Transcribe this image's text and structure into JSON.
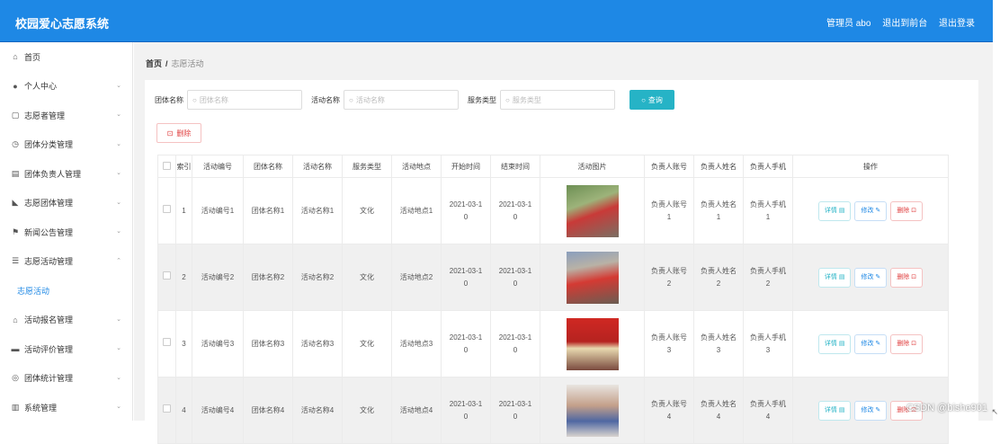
{
  "header": {
    "title": "校园爱心志愿系统",
    "admin": "管理员 abo",
    "back_front": "退出到前台",
    "logout": "退出登录"
  },
  "sidebar": {
    "items": [
      {
        "label": "首页",
        "icon": "home-icon",
        "glyph": "⌂",
        "chev": ""
      },
      {
        "label": "个人中心",
        "icon": "user-icon",
        "glyph": "●",
        "chev": "⌄"
      },
      {
        "label": "志愿者管理",
        "icon": "card-icon",
        "glyph": "▢",
        "chev": "⌄"
      },
      {
        "label": "团体分类管理",
        "icon": "clock-icon",
        "glyph": "◷",
        "chev": "⌄"
      },
      {
        "label": "团体负责人管理",
        "icon": "book-icon",
        "glyph": "▤",
        "chev": "⌄"
      },
      {
        "label": "志愿团体管理",
        "icon": "thumb-icon",
        "glyph": "◣",
        "chev": "⌄"
      },
      {
        "label": "新闻公告管理",
        "icon": "flag-icon",
        "glyph": "⚑",
        "chev": "⌄"
      },
      {
        "label": "志愿活动管理",
        "icon": "list-icon",
        "glyph": "☰",
        "chev": "⌃"
      },
      {
        "label": "志愿活动",
        "icon": "",
        "glyph": "",
        "chev": "",
        "sub": true
      },
      {
        "label": "活动报名管理",
        "icon": "bank-icon",
        "glyph": "⌂",
        "chev": "⌄"
      },
      {
        "label": "活动评价管理",
        "icon": "folder-icon",
        "glyph": "▬",
        "chev": "⌄"
      },
      {
        "label": "团体统计管理",
        "icon": "globe-icon",
        "glyph": "◎",
        "chev": "⌄"
      },
      {
        "label": "系统管理",
        "icon": "chart-icon",
        "glyph": "▥",
        "chev": "⌄"
      }
    ]
  },
  "breadcrumb": {
    "home": "首页",
    "sep": "/",
    "current": "志愿活动"
  },
  "search": {
    "group_label": "团体名称",
    "group_placeholder": "团体名称",
    "activity_label": "活动名称",
    "activity_placeholder": "活动名称",
    "service_label": "服务类型",
    "service_placeholder": "服务类型",
    "query": "查询"
  },
  "delete_button": "删除",
  "table": {
    "headers": [
      "索引",
      "活动编号",
      "团体名称",
      "活动名称",
      "服务类型",
      "活动地点",
      "开始时间",
      "结束时间",
      "活动图片",
      "负责人账号",
      "负责人姓名",
      "负责人手机",
      "操作"
    ],
    "rows": [
      {
        "idx": "1",
        "code": "活动编号1",
        "group": "团体名称1",
        "name": "活动名称1",
        "type": "文化",
        "place": "活动地点1",
        "start": "2021-03-1\n0",
        "end": "2021-03-1\n0",
        "account": "负责人账号\n1",
        "leader": "负责人姓名\n1",
        "phone": "负责人手机\n1"
      },
      {
        "idx": "2",
        "code": "活动编号2",
        "group": "团体名称2",
        "name": "活动名称2",
        "type": "文化",
        "place": "活动地点2",
        "start": "2021-03-1\n0",
        "end": "2021-03-1\n0",
        "account": "负责人账号\n2",
        "leader": "负责人姓名\n2",
        "phone": "负责人手机\n2"
      },
      {
        "idx": "3",
        "code": "活动编号3",
        "group": "团体名称3",
        "name": "活动名称3",
        "type": "文化",
        "place": "活动地点3",
        "start": "2021-03-1\n0",
        "end": "2021-03-1\n0",
        "account": "负责人账号\n3",
        "leader": "负责人姓名\n3",
        "phone": "负责人手机\n3"
      },
      {
        "idx": "4",
        "code": "活动编号4",
        "group": "团体名称4",
        "name": "活动名称4",
        "type": "文化",
        "place": "活动地点4",
        "start": "2021-03-1\n0",
        "end": "2021-03-1\n0",
        "account": "负责人账号\n4",
        "leader": "负责人姓名\n4",
        "phone": "负责人手机\n4"
      }
    ],
    "ops": {
      "detail": "详情 ▤",
      "edit": "修改 ✎",
      "remove": "删除 ⊡"
    }
  },
  "watermark": "CSDN @bishe901"
}
